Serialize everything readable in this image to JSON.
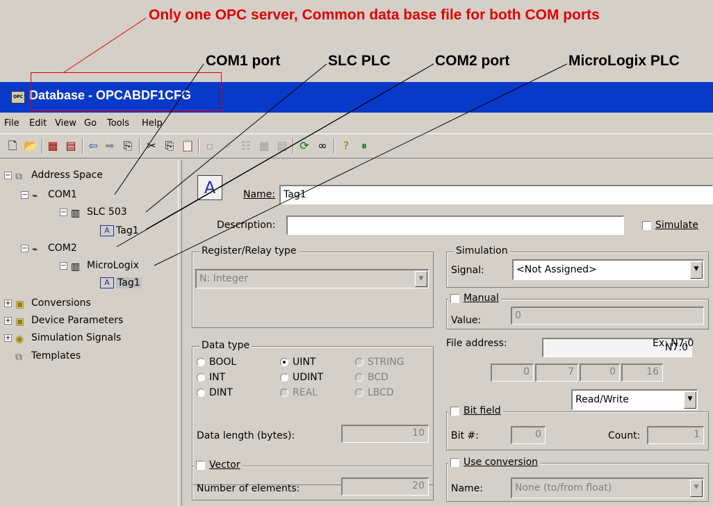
{
  "annotations": {
    "title": "Only one OPC server, Common data base file for both COM ports",
    "com1": "COM1 port",
    "slc": "SLC PLC",
    "com2": "COM2 port",
    "micrologix": "MicroLogix PLC"
  },
  "window": {
    "title": "Database - OPCABDF1CFG",
    "icon_text": "OPC"
  },
  "menu": [
    "File",
    "Edit",
    "View",
    "Go",
    "Tools",
    "Help"
  ],
  "tree": {
    "address_space": "Address Space",
    "com1": "COM1",
    "slc503": "SLC 503",
    "tag1a": "Tag1",
    "com2": "COM2",
    "micrologix": "MicroLogix",
    "tag1b": "Tag1",
    "conversions": "Conversions",
    "device_parameters": "Device Parameters",
    "simulation_signals": "Simulation Signals",
    "templates": "Templates"
  },
  "form": {
    "name_label": "Name:",
    "name_value": "Tag1",
    "description_label": "Description:",
    "description_value": "",
    "simulate_label": "Simulate",
    "register_group": "Register/Relay type",
    "register_value": "N: Integer",
    "simulation_group": "Simulation",
    "signal_label": "Signal:",
    "signal_value": "<Not Assigned>",
    "manual_label": "Manual",
    "value_label": "Value:",
    "value_value": "0",
    "datatype_group": "Data type",
    "dt_bool": "BOOL",
    "dt_uint": "UINT",
    "dt_string": "STRING",
    "dt_int": "INT",
    "dt_udint": "UDINT",
    "dt_bcd": "BCD",
    "dt_dint": "DINT",
    "dt_real": "REAL",
    "dt_lbcd": "LBCD",
    "data_length_label": "Data length (bytes):",
    "data_length_value": "10",
    "vector_label": "Vector",
    "num_elements_label": "Number of elements:",
    "num_elements_value": "20",
    "file_address_label": "File address:",
    "file_address_value": "N7:0",
    "file_address_example": "Ex: N7:0",
    "addr_parts": [
      "0",
      "7",
      "0",
      "16"
    ],
    "access_value": "Read/Write",
    "bitfield_label": "Bit field",
    "bit_label": "Bit #:",
    "bit_value": "0",
    "count_label": "Count:",
    "count_value": "1",
    "use_conversion_label": "Use conversion",
    "conv_name_label": "Name:",
    "conv_name_value": "None (to/from float)"
  }
}
